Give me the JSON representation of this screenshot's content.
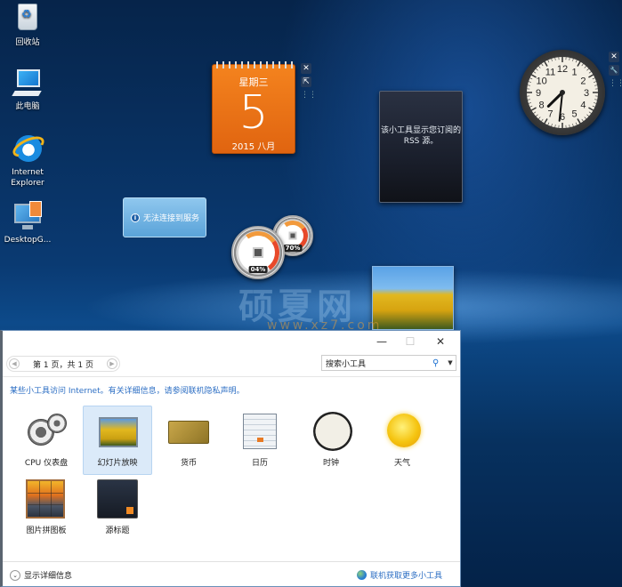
{
  "desktop": {
    "icons": [
      {
        "label": "回收站",
        "icon": "recycle-bin-icon"
      },
      {
        "label": "此电脑",
        "icon": "computer-icon"
      },
      {
        "label": "Internet Explorer",
        "icon": "internet-explorer-icon"
      },
      {
        "label": "DesktopG...",
        "icon": "desktop-gadgets-icon"
      }
    ],
    "watermark": "硕夏网",
    "watermark_url": "www.xz7.com"
  },
  "gadgets": {
    "calendar": {
      "weekday": "星期三",
      "day": "5",
      "year_month": "2015 八月"
    },
    "calendar_controls": {
      "close": "✕",
      "size": "⇱",
      "drag": "⋮⋮"
    },
    "rss": {
      "message": "该小工具显示您订阅的 RSS 源。"
    },
    "clock": {
      "hour": 7,
      "minute": 31
    },
    "clock_controls": {
      "close": "✕",
      "options": "🔧",
      "drag": "⋮⋮"
    },
    "weather": {
      "message": "无法连接到服务"
    },
    "cpu_meter": {
      "cpu_percent": "04%",
      "memory_percent": "70%"
    }
  },
  "window": {
    "controls": {
      "minimize": "—",
      "maximize": "☐",
      "close": "✕"
    },
    "pager": {
      "prev": "◀",
      "label": "第 1 页，共 1 页",
      "next": "▶"
    },
    "search": {
      "placeholder": "搜索小工具",
      "icon": "🔍",
      "dropdown": "▼"
    },
    "notice": "某些小工具访问 Internet。有关详细信息，请参阅联机隐私声明。",
    "gadgets": [
      {
        "label": "CPU 仪表盘",
        "selected": false
      },
      {
        "label": "幻灯片放映",
        "selected": true
      },
      {
        "label": "货币",
        "selected": false
      },
      {
        "label": "日历",
        "selected": false
      },
      {
        "label": "时钟",
        "selected": false
      },
      {
        "label": "天气",
        "selected": false
      },
      {
        "label": "图片拼图板",
        "selected": false
      },
      {
        "label": "源标题",
        "selected": false
      }
    ],
    "footer": {
      "show_details": "显示详细信息",
      "show_details_icon": "⌄",
      "get_more": "联机获取更多小工具"
    }
  }
}
